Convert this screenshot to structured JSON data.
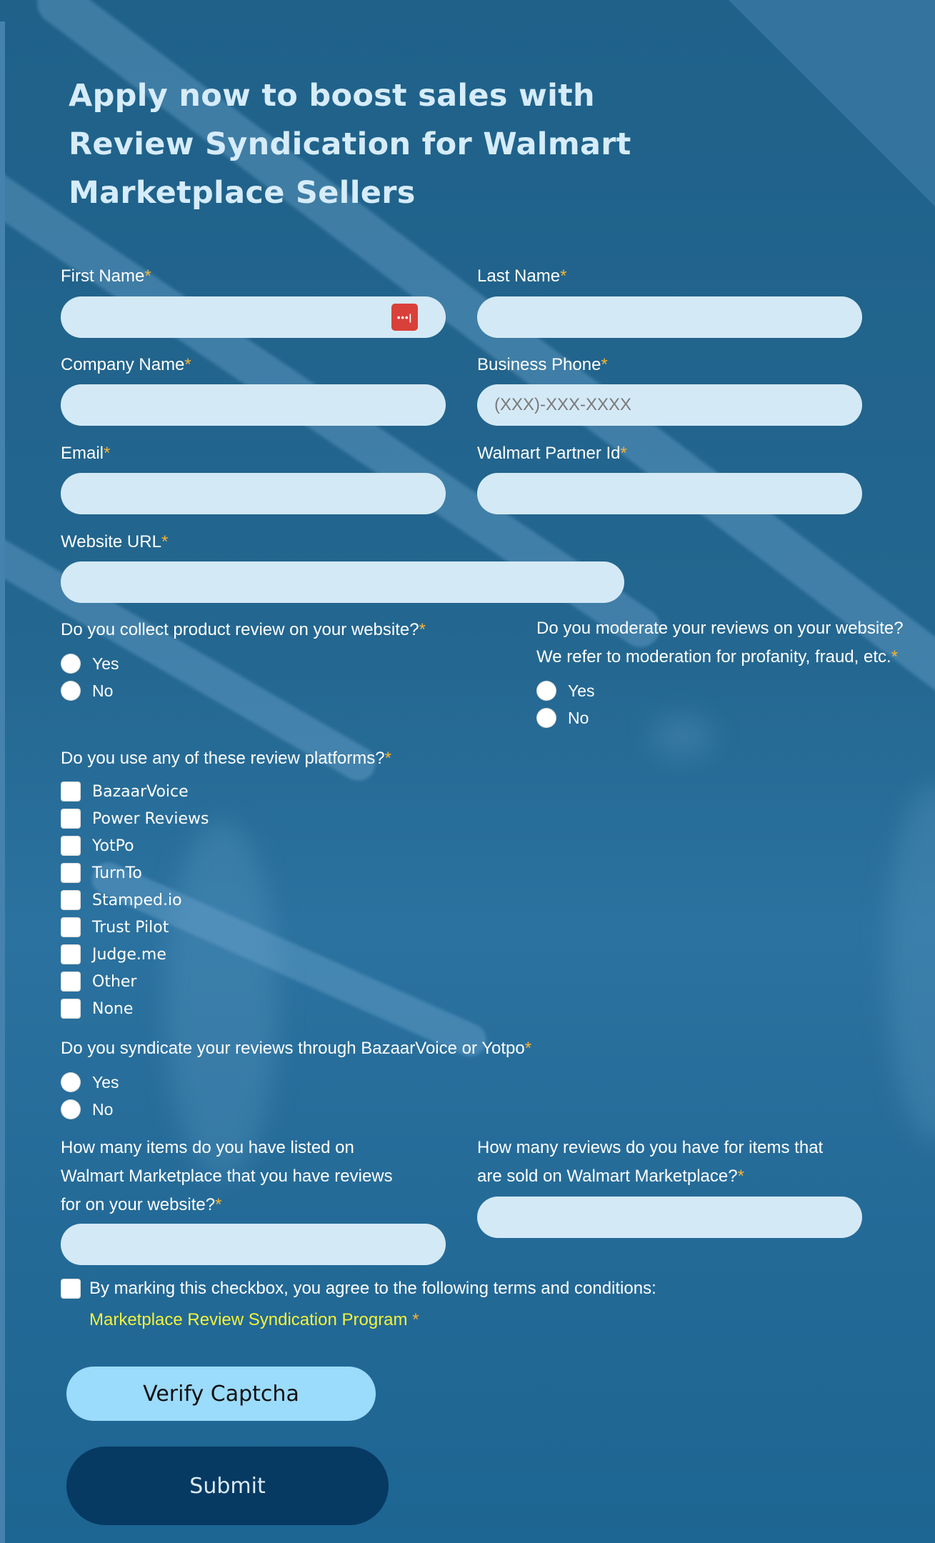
{
  "form": {
    "title": "Apply now to boost sales with Review Syndication for Walmart Marketplace Sellers",
    "required_marker": "*",
    "fields": {
      "first_name": {
        "label": "First Name",
        "value": "",
        "placeholder": ""
      },
      "last_name": {
        "label": "Last Name",
        "value": "",
        "placeholder": ""
      },
      "company_name": {
        "label": "Company Name",
        "value": "",
        "placeholder": ""
      },
      "business_phone": {
        "label": "Business Phone",
        "value": "",
        "placeholder": "(XXX)-XXX-XXXX"
      },
      "email": {
        "label": "Email",
        "value": "",
        "placeholder": ""
      },
      "walmart_partner_id": {
        "label": "Walmart Partner Id",
        "value": "",
        "placeholder": ""
      },
      "website_url": {
        "label": "Website URL",
        "value": "",
        "placeholder": ""
      }
    },
    "password_manager_icon": "password-dots-icon",
    "questions": {
      "collect_reviews": {
        "label": "Do you collect product review on your website?",
        "options": [
          "Yes",
          "No"
        ]
      },
      "moderate_reviews": {
        "label_line1": "Do you moderate your reviews on your website?",
        "label_line2": "We refer to moderation for profanity, fraud, etc.",
        "options": [
          "Yes",
          "No"
        ]
      },
      "review_platforms": {
        "label": "Do you use any of these review platforms?",
        "options": [
          "BazaarVoice",
          "Power Reviews",
          "YotPo",
          "TurnTo",
          "Stamped.io",
          "Trust Pilot",
          "Judge.me",
          "Other",
          "None"
        ]
      },
      "syndicate": {
        "label": "Do you syndicate your reviews through BazaarVoice or Yotpo",
        "options": [
          "Yes",
          "No"
        ]
      },
      "items_listed": {
        "label_lines": [
          "How many items do you have listed on",
          "Walmart Marketplace that you have reviews",
          "for on your website?"
        ],
        "value": ""
      },
      "reviews_count": {
        "label_lines": [
          "How many reviews do you have for items that",
          "are sold on Walmart Marketplace?"
        ],
        "value": ""
      }
    },
    "terms": {
      "text": "By marking this checkbox, you agree to the following terms and conditions:",
      "link": "Marketplace Review Syndication Program",
      "checked": false
    },
    "buttons": {
      "verify_captcha": "Verify Captcha",
      "submit": "Submit"
    },
    "colors": {
      "background": "#1f628c",
      "input_bg": "#d4e9f6",
      "required": "#f5b335",
      "link": "#f2f23a",
      "verify_button": "#9bdbfb",
      "submit_button": "#063a62"
    }
  }
}
